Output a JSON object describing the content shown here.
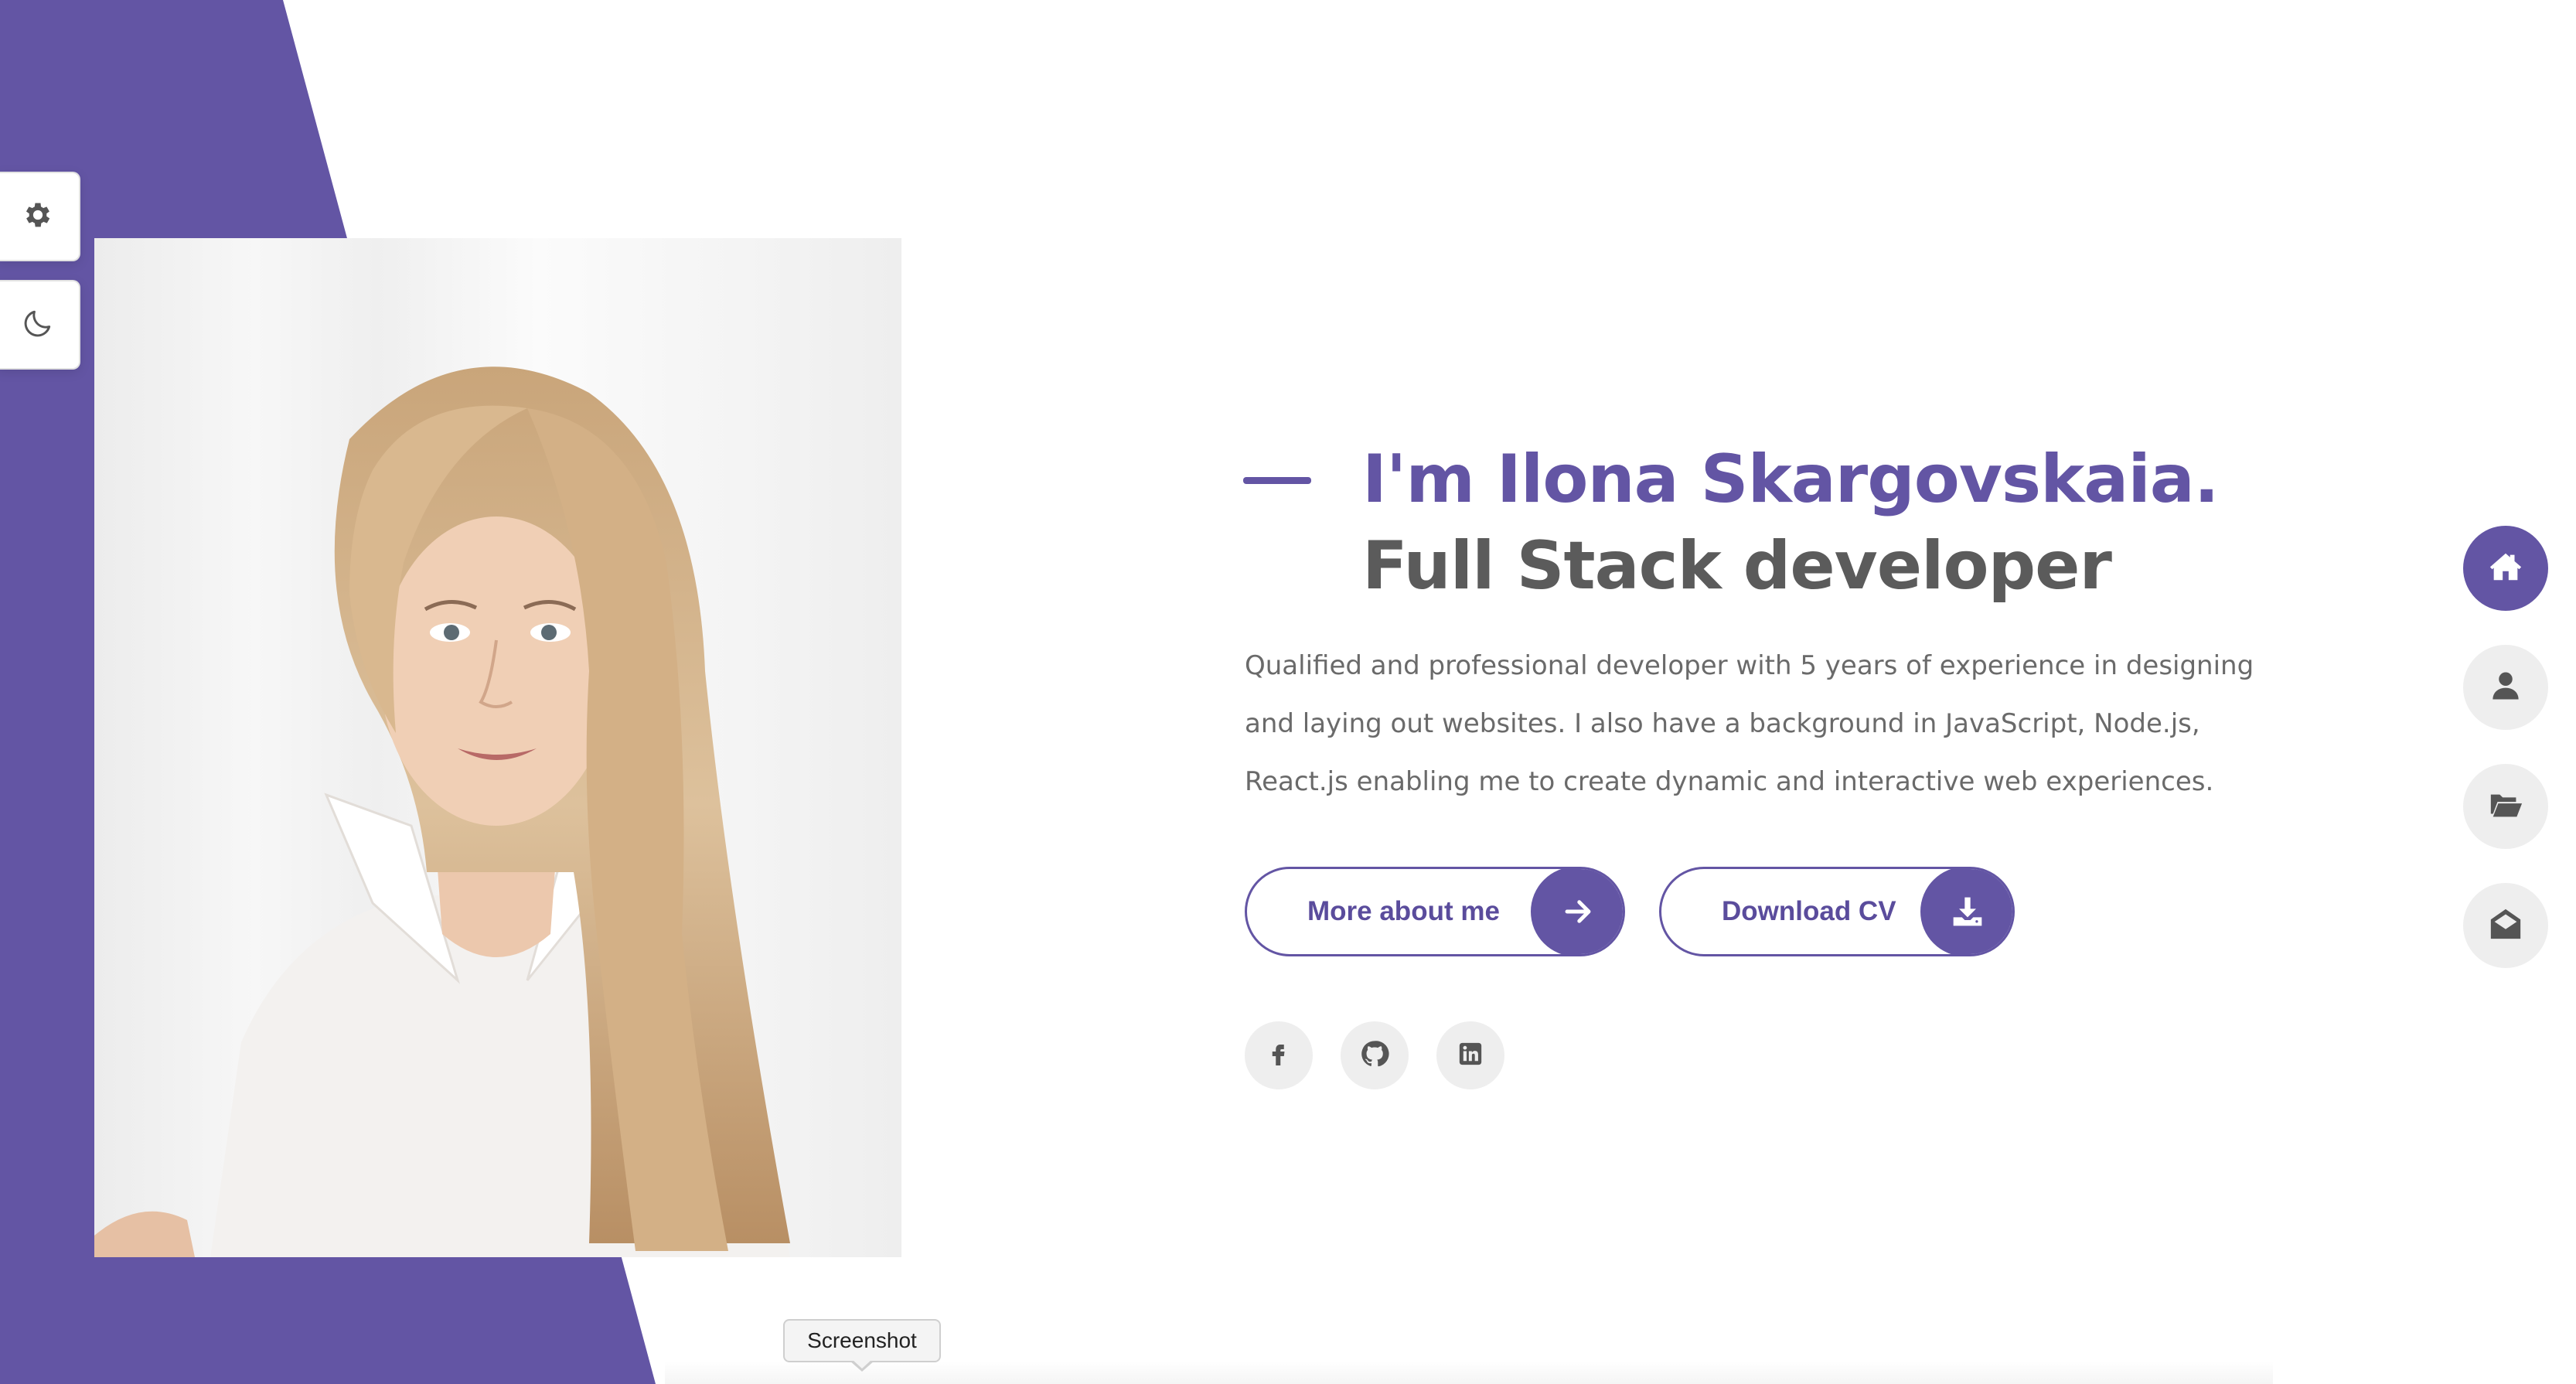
{
  "theme": {
    "accent": "#6355a4",
    "heading_secondary": "#5b5b5b",
    "body_text": "#6a6a6a",
    "icon_bg": "#eeeeee"
  },
  "tools": {
    "settings_icon": "gear-icon",
    "theme_icon": "moon-icon"
  },
  "portrait": {
    "icon": "portrait-photo"
  },
  "hero": {
    "name": "I'm Ilona Skargovskaia.",
    "role": "Full Stack developer",
    "description": "Qualified and professional developer with 5 years of experience in designing and laying out websites. I also have a background in JavaScript, Node.js, React.js enabling me to create dynamic and interactive web experiences."
  },
  "buttons": {
    "more_label": "More about me",
    "more_icon": "arrow-right-icon",
    "cv_label": "Download CV",
    "cv_icon": "download-icon"
  },
  "socials": [
    {
      "icon": "facebook-icon"
    },
    {
      "icon": "github-icon"
    },
    {
      "icon": "linkedin-icon"
    }
  ],
  "nav": [
    {
      "icon": "home-icon",
      "active": true
    },
    {
      "icon": "user-icon",
      "active": false
    },
    {
      "icon": "folder-open-icon",
      "active": false
    },
    {
      "icon": "envelope-open-icon",
      "active": false
    }
  ],
  "tooltip": {
    "text": "Screenshot"
  }
}
